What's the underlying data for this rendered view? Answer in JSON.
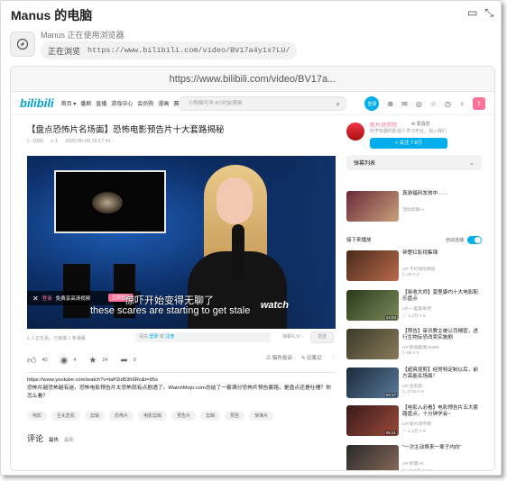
{
  "header": {
    "title": "Manus 的电脑"
  },
  "status": {
    "text": "Manus 正在使用浏览器",
    "action": "正在浏览",
    "url": "https://www.bilibili.com/video/BV17a4y1x7LU/"
  },
  "browser": {
    "address": "https://www.bilibili.com/video/BV17a..."
  },
  "nav": {
    "logo": "bilibili",
    "links": [
      "首页 ▾",
      "番剧",
      "直播",
      "游戏中心",
      "会员购",
      "漫画",
      "赛事"
    ],
    "search_placeholder": "小鸭梅可洋·8小时前更新",
    "login": "登录"
  },
  "video": {
    "title": "【盘点恐怖片名场面】恐怖电影预告片十大套路揭秘",
    "views": "1090",
    "danmaku_count": "1",
    "date": "2020-06-09 19:17:41",
    "toast_close": "✕",
    "toast_tag": "登录",
    "toast_text": "免费享高清视频",
    "toast_btn": "立即登录",
    "subtitle_cn": "惊吓开始变得无聊了",
    "subtitle_en": "these scares are starting to get stale",
    "watermark": "watch",
    "watching": "1 人正在看，已装填 1 条弹幕",
    "dm_input_prefix": "请先",
    "dm_login": "登录",
    "dm_or": "或",
    "dm_register": "注册",
    "etiquette": "弹幕礼仪 ›",
    "send": "发送"
  },
  "actions": {
    "like": "40",
    "coin": "4",
    "fav": "24",
    "share": "9",
    "report": "稿件投诉",
    "note": "记笔记"
  },
  "description": {
    "url": "https://www.youtube.com/watch?v=laP2id53h6Rc&t=95s",
    "text": "恐怖片越恐怖越有迷，恐怖电影预告片太恐怖就有点剧透了。WatchMojo.com总结了一套满分恐怖片预告套路，是盘点还是吐槽？你怎么看？"
  },
  "tags": [
    "电影",
    "生化危机",
    "剪辑",
    "恐怖片",
    "电影剪辑",
    "预告片",
    "剪辑",
    "预告",
    "惊悚片"
  ],
  "comments": {
    "title": "评论",
    "sort_hot": "最热",
    "sort_new": "最新"
  },
  "uploader": {
    "name": "新片场学院",
    "message": "✉ 发消息",
    "sign": "好学有趣的影视人学习平台，加入我们",
    "follow": "+ 关注 7.8万"
  },
  "sidebar": {
    "danmaku_list": "弹幕列表",
    "next_label": "接下来播放",
    "autoplay": "自动连播",
    "cards": [
      {
        "title": "真游福利发放中……",
        "author": "活动剪辑++",
        "stats": "",
        "duration": "",
        "color1": "#6a2a3a",
        "color2": "#c9a07a"
      },
      {
        "title": "钟楚红影视集锦",
        "author": "UP 不打烊的桥段",
        "stats": "▷ 28  ≡ 0",
        "duration": "",
        "color1": "#4a2a1a",
        "color2": "#b86a4a"
      },
      {
        "title": "【吸收大师】莫里康内十大电影配乐盘点",
        "author": "UP 一起吸氧吧",
        "stats": "▷ 1.2万  ≡ 6",
        "duration": "14:04",
        "color1": "#2a3a1a",
        "color2": "#7a8a5a"
      },
      {
        "title": "【预告】审讯教主被公司揭密，进行生物反恐改卖实施剧",
        "author": "UP 影视剧情ADDR",
        "stats": "▷ 68  ≡ 0",
        "duration": "",
        "color1": "#3a3a2a",
        "color2": "#8a7a5a"
      },
      {
        "title": "【超爽混剪】经常特定制以后，前方高能名场面！",
        "author": "UP 名剪剪",
        "stats": "▷ 1743  ≡ 0",
        "duration": "04:17",
        "color1": "#1a2a3a",
        "color2": "#5a7a9a"
      },
      {
        "title": "【电影入必看】电影预告片五大套路盘点，十分钟学会~",
        "author": "UP 新片场学院",
        "stats": "▷ 1.2万  ≡ 9",
        "duration": "08:21",
        "color1": "#3a1a1a",
        "color2": "#9a4a3a"
      },
      {
        "title": "\"一次主动换来一辈子内向\"",
        "author": "UP 积累Art",
        "stats": "▷ 64.6万  ≡ 156",
        "duration": "00:59",
        "color1": "#2a2a2a",
        "color2": "#8a6a5a"
      }
    ]
  },
  "colors": {
    "bili_blue": "#00aeec",
    "bili_pink": "#fb7299"
  }
}
